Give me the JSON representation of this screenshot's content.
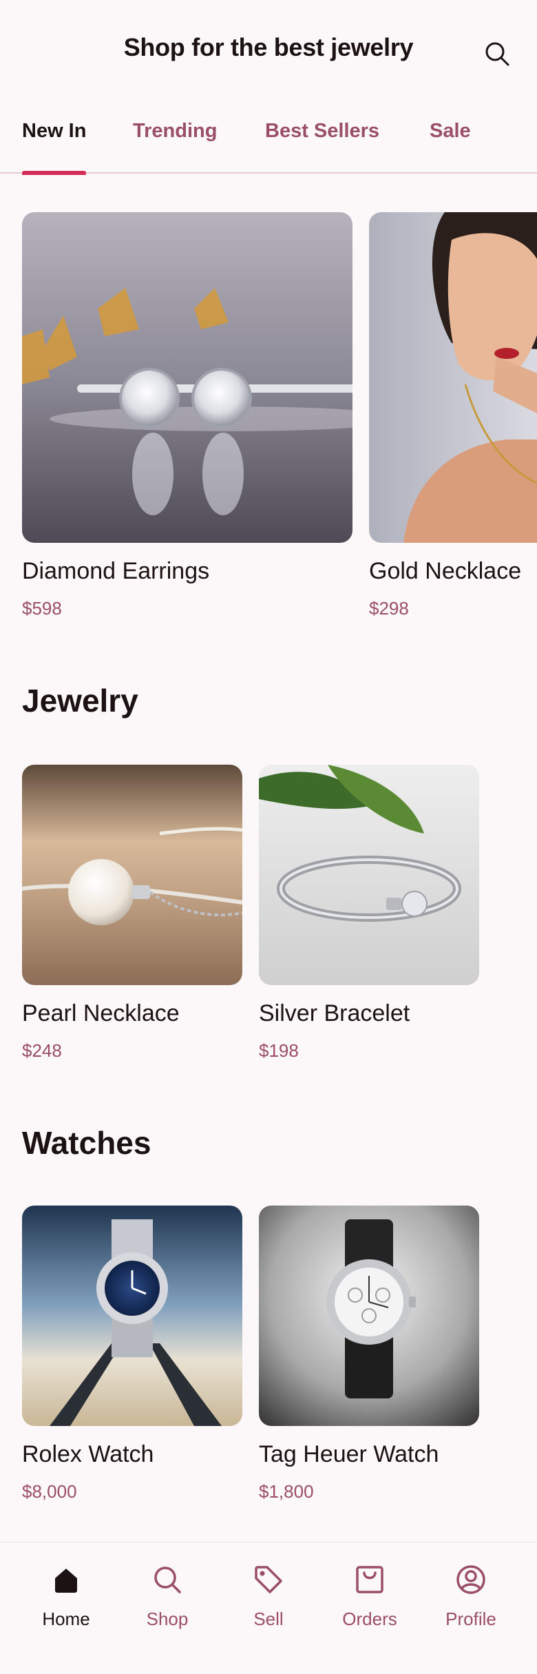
{
  "header": {
    "title": "Shop for the best jewelry"
  },
  "tabs": [
    {
      "label": "New In",
      "active": true
    },
    {
      "label": "Trending",
      "active": false
    },
    {
      "label": "Best Sellers",
      "active": false
    },
    {
      "label": "Sale",
      "active": false
    }
  ],
  "featured": [
    {
      "name": "Diamond Earrings",
      "price": "$598"
    },
    {
      "name": "Gold Necklace",
      "price": "$298"
    }
  ],
  "sections": [
    {
      "title": "Jewelry",
      "items": [
        {
          "name": "Pearl Necklace",
          "price": "$248"
        },
        {
          "name": "Silver Bracelet",
          "price": "$198"
        }
      ]
    },
    {
      "title": "Watches",
      "items": [
        {
          "name": "Rolex Watch",
          "price": "$8,000"
        },
        {
          "name": "Tag Heuer Watch",
          "price": "$1,800"
        }
      ]
    }
  ],
  "bottom_nav": [
    {
      "label": "Home",
      "icon": "home-icon",
      "active": true
    },
    {
      "label": "Shop",
      "icon": "search-icon",
      "active": false
    },
    {
      "label": "Sell",
      "icon": "tag-icon",
      "active": false
    },
    {
      "label": "Orders",
      "icon": "bag-icon",
      "active": false
    },
    {
      "label": "Profile",
      "icon": "profile-icon",
      "active": false
    }
  ],
  "colors": {
    "background": "#fcf7f8",
    "accent": "#d32d59",
    "muted_text": "#9b4e67",
    "primary_text": "#1c1214"
  }
}
